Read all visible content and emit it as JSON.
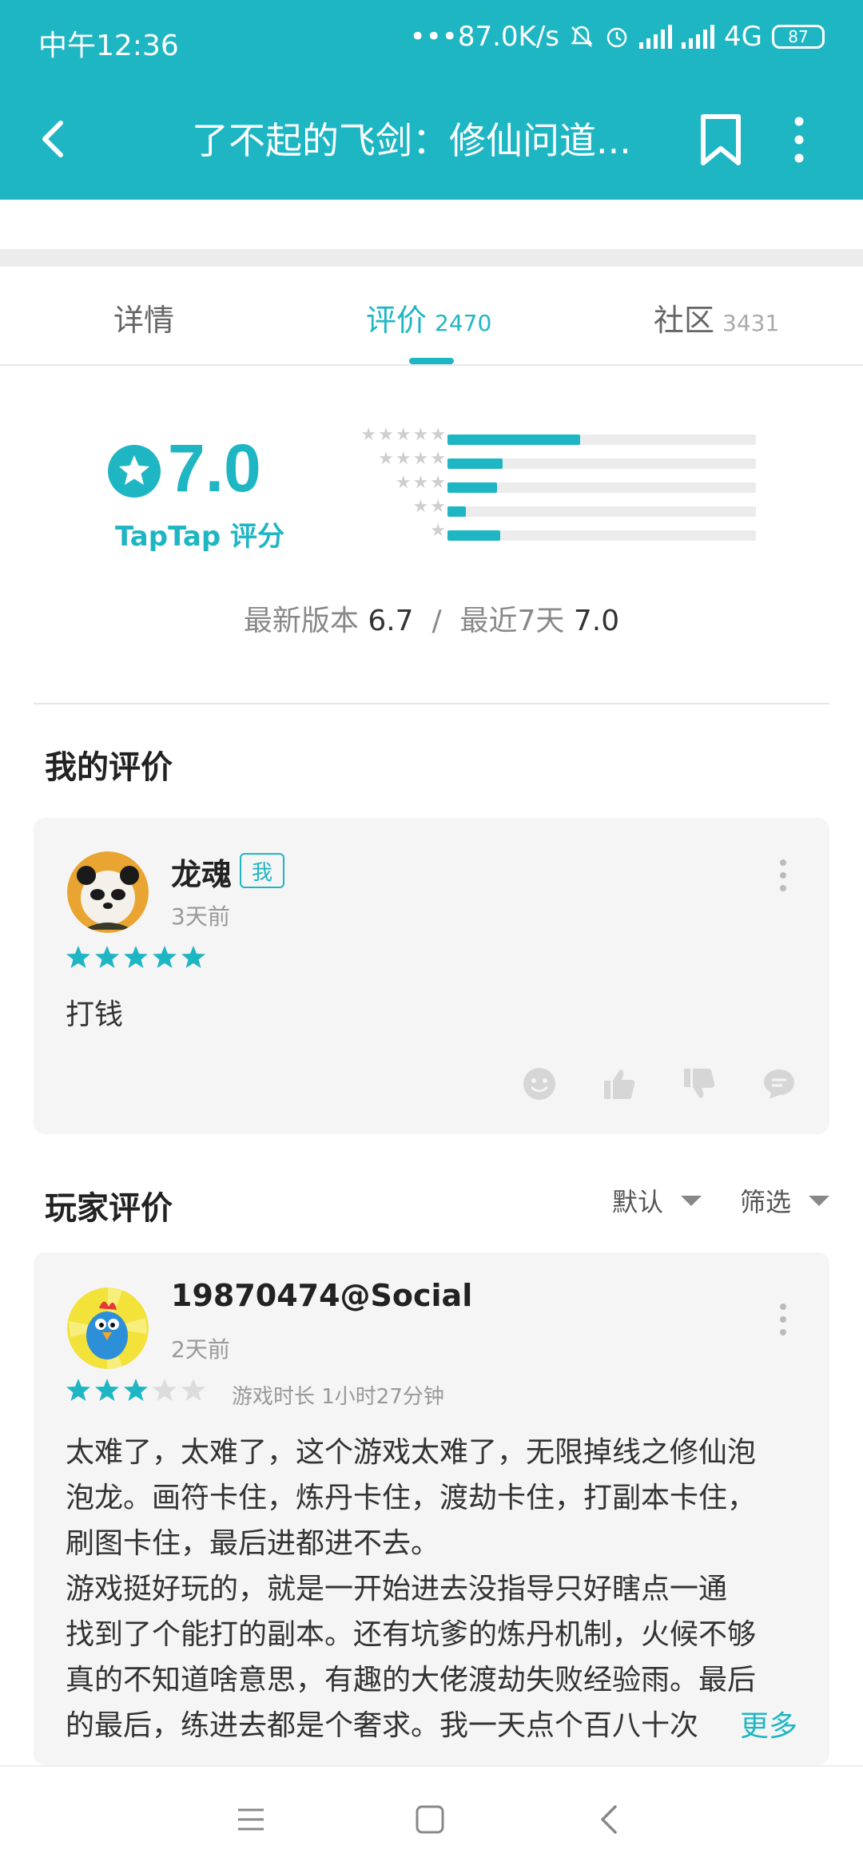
{
  "status_bar": {
    "time": "中午12:36",
    "network_speed": "•••87.0K/s",
    "network_type": "4G",
    "battery": "87"
  },
  "app_bar": {
    "title": "了不起的飞剑：修仙问道...",
    "icons": [
      "back-arrow-icon",
      "bookmark-icon",
      "more-vertical-icon"
    ]
  },
  "tabs": [
    {
      "label": "详情",
      "count": ""
    },
    {
      "label": "评价",
      "count": "2470"
    },
    {
      "label": "社区",
      "count": "3431"
    }
  ],
  "active_tab": "评价",
  "rating": {
    "score": "7.0",
    "brand": "TapTap",
    "label": "评分",
    "distribution": [
      {
        "stars": 5,
        "stars_text": "★★★★★",
        "fraction": 0.43
      },
      {
        "stars": 4,
        "stars_text": "★★★★",
        "fraction": 0.18
      },
      {
        "stars": 3,
        "stars_text": "★★★",
        "fraction": 0.16
      },
      {
        "stars": 2,
        "stars_text": "★★",
        "fraction": 0.06
      },
      {
        "stars": 1,
        "stars_text": "★",
        "fraction": 0.17
      }
    ],
    "latest_version_label": "最新版本",
    "latest_version_score": "6.7",
    "separator": "/",
    "recent_label": "最近7天",
    "recent_score": "7.0"
  },
  "my_review": {
    "section_title": "我的评价",
    "username": "龙魂",
    "me_badge": "我",
    "time_ago": "3天前",
    "stars": 5,
    "text": "打钱",
    "actions": [
      "smiley-icon",
      "thumbs-up-icon",
      "thumbs-down-icon",
      "comment-icon"
    ]
  },
  "player_reviews": {
    "section_title": "玩家评价",
    "sort_label": "默认",
    "filter_label": "筛选",
    "items": [
      {
        "username": "19870474@Social",
        "time_ago": "2天前",
        "stars": 3,
        "playtime": "游戏时长 1小时27分钟",
        "lines": [
          "太难了，太难了，这个游戏太难了，无限掉线之修仙泡",
          "泡龙。画符卡住，炼丹卡住，渡劫卡住，打副本卡住，",
          "刷图卡住，最后进都进不去。",
          "游戏挺好玩的，就是一开始进去没指导只好瞎点一通",
          "找到了个能打的副本。还有坑爹的炼丹机制，火候不够",
          "真的不知道啥意思，有趣的大佬渡劫失败经验雨。最后",
          "的最后，练进去都是个奢求。我一天点个百八十次"
        ],
        "more_label": "更多"
      }
    ]
  },
  "colors": {
    "accent": "#1fb6c4",
    "card_bg": "#f5f5f5"
  },
  "nav_bar": {
    "icons": [
      "menu-icon",
      "home-square-icon",
      "back-chevron-icon"
    ]
  }
}
